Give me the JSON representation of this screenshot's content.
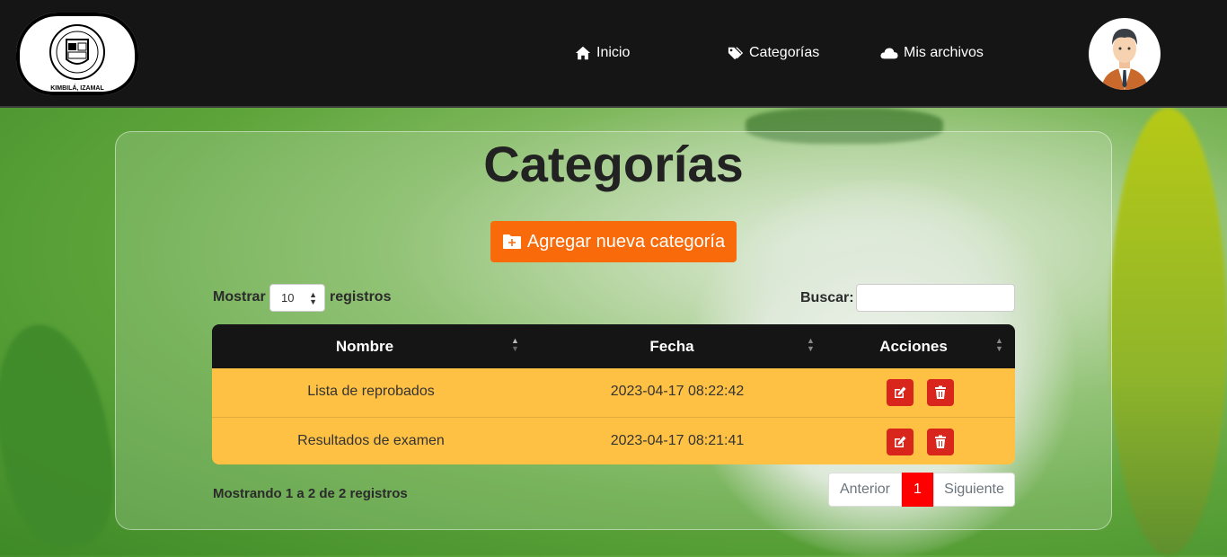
{
  "nav": {
    "logo_text": "KIMBILÁ, IZAMAL",
    "items": [
      {
        "label": "Inicio",
        "icon": "home-icon"
      },
      {
        "label": "Categorías",
        "icon": "tags-icon"
      },
      {
        "label": "Mis archivos",
        "icon": "cloud-icon"
      }
    ],
    "avatar_icon": "user-avatar-icon"
  },
  "page": {
    "title": "Categorías",
    "add_button": "Agregar nueva categoría"
  },
  "table_controls": {
    "show_label": "Mostrar",
    "page_size": "10",
    "records_label": "registros",
    "search_label": "Buscar:",
    "search_value": ""
  },
  "table": {
    "columns": [
      "Nombre",
      "Fecha",
      "Acciones"
    ],
    "rows": [
      {
        "nombre": "Lista de reprobados",
        "fecha": "2023-04-17 08:22:42"
      },
      {
        "nombre": "Resultados de examen",
        "fecha": "2023-04-17 08:21:41"
      }
    ]
  },
  "footer": {
    "info": "Mostrando 1 a 2 de 2 registros",
    "prev": "Anterior",
    "current_page": "1",
    "next": "Siguiente"
  },
  "colors": {
    "navbar": "#151515",
    "add_button": "#f86a0a",
    "row": "#ffc144",
    "action_button": "#d8261c",
    "current_page": "#ff0000"
  }
}
